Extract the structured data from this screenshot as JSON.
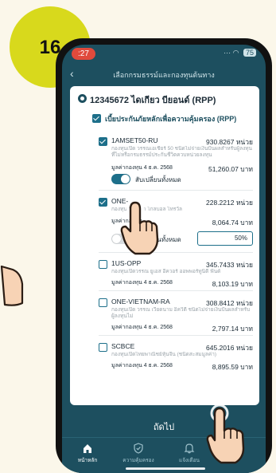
{
  "step": "16",
  "status": {
    "time": ":27",
    "battery": "75"
  },
  "header": {
    "title": "เลือกกรมธรรม์และกองทุนต้นทาง"
  },
  "policy": {
    "name": "12345672 ไดเกียว บียอนด์ (RPP)"
  },
  "section": {
    "title": "เบี้ยประกันภัยหลักเพื่อความคุ้มครอง (RPP)"
  },
  "funds": [
    {
      "code": "1AMSET50-RU",
      "units": "930.8267 หน่วย",
      "desc": "กองทุนเปิด วรรณเอเชียร์ 50 ชนิดไม่จ่ายเงินปันผลสำหรับผู้ลงทุนที่ไม่หรือกรมธรรม์ประกันชีวิตควบหน่วยลงทุน",
      "nav_label": "มูลค่ากองทุน 4 ธ.ค. 2568",
      "value": "51,260.07 บาท"
    },
    {
      "code": "ONE-",
      "units": "228.2212 หน่วย",
      "desc": "กองทุนเปิด ... ก โกลบอล ไทรวัล",
      "nav_label": "มูลค่ากองทุน",
      "value": "8,064.74 บาท"
    },
    {
      "code": "1US-OPP",
      "units": "345.7433 หน่วย",
      "desc": "กองทุนเปิดวรรณ ยูเอส อีควอร์ ออพพอร์ทูนิตี้ ฟันด์",
      "nav_label": "มูลค่ากองทุน 4 ธ.ค. 2568",
      "value": "8,103.19 บาท"
    },
    {
      "code": "ONE-VIETNAM-RA",
      "units": "308.8412 หน่วย",
      "desc": "กองทุนเปิด วรรณ เวียดนาม อิควิตี้ ชนิดไม่จ่ายเงินปันผลสำหรับผู้ลงทุนไม่",
      "nav_label": "มูลค่ากองทุน 4 ธ.ค. 2568",
      "value": "2,797.14 บาท"
    },
    {
      "code": "SCBCE",
      "units": "645.2016 หน่วย",
      "desc": "กองทุนเปิดไทยพาณิชย์หุ้นจีน (ชนิดสะสมมูลค่า)",
      "nav_label": "มูลค่ากองทุน 4 ธ.ค. 2568",
      "value": "8,895.59 บาท"
    }
  ],
  "toggles": {
    "switch_all_label": "สับเปลี่ยนทั้งหมด",
    "percent_value": "50%"
  },
  "next_button": {
    "label": "ถัดไป"
  },
  "nav": [
    {
      "label": "หน้าหลัก",
      "icon": "home-icon"
    },
    {
      "label": "ความคุ้มครอง",
      "icon": "shield-icon"
    },
    {
      "label": "แจ้งเตือน",
      "icon": "bell-icon"
    }
  ],
  "colors": {
    "accent": "#1d6f8a",
    "header_bg": "#1d4f5f",
    "badge": "#d8d91c",
    "background": "#fbf7ea"
  }
}
